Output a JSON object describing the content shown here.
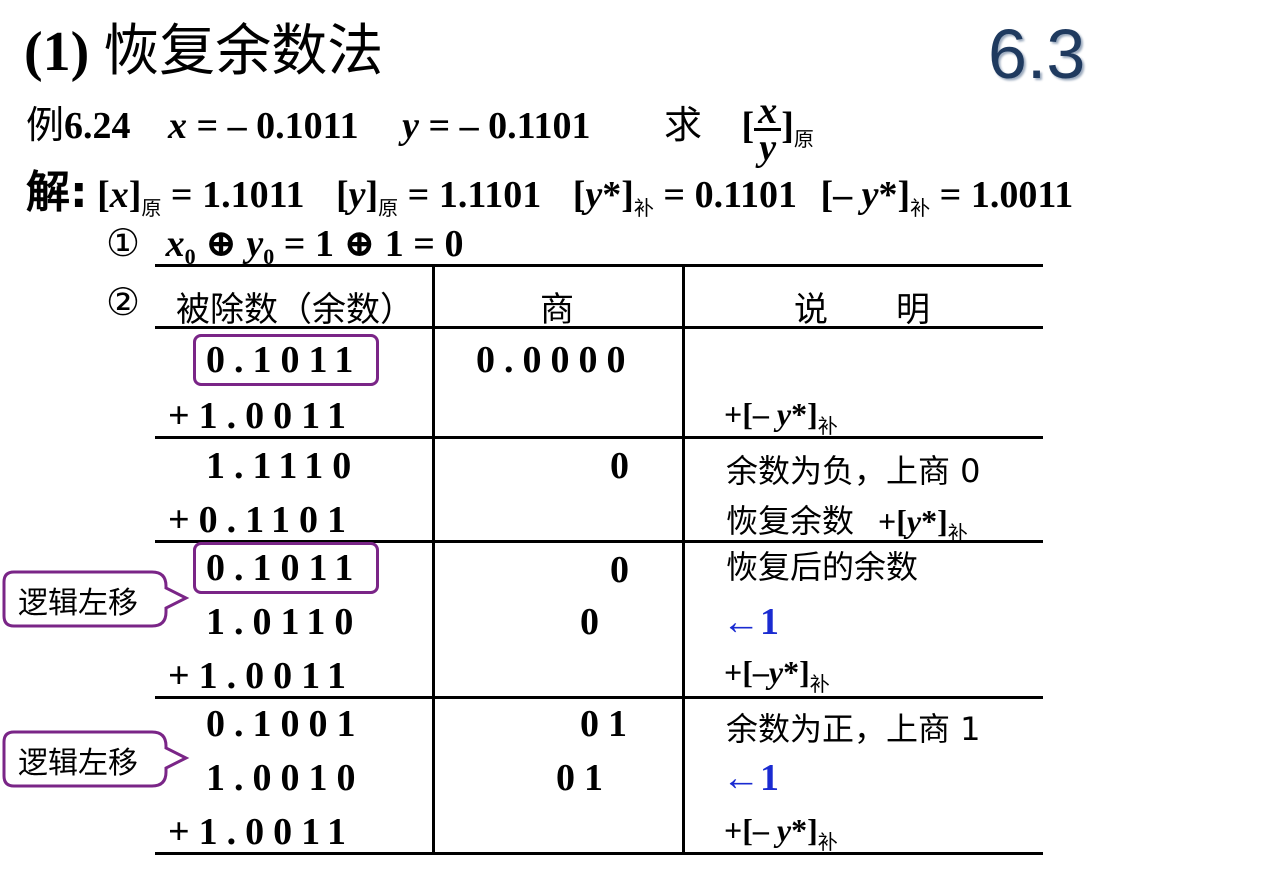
{
  "title": {
    "prefix": "(1) ",
    "text": "恢复余数法"
  },
  "section_number": "6.3",
  "example": {
    "label_zh": "例",
    "num": "6.24",
    "x_expr": "= – 0.1011",
    "y_expr": "= – 0.1101",
    "ask": "求",
    "sub": "原"
  },
  "solution": {
    "label": "解:",
    "x_orig": "= 1.1011",
    "y_orig": "= 1.1101",
    "ystar_comp": "= 0.1101",
    "negystar_comp": "= 1.0011",
    "sub_orig": "原",
    "sub_comp": "补"
  },
  "step1": {
    "marker": "①",
    "expr": "= 1 ⊕ 1 = 0"
  },
  "step2": {
    "marker": "②"
  },
  "table": {
    "headers": [
      "被除数（余数）",
      "商",
      "说　　明"
    ],
    "rows": [
      {
        "dividend": "0.1011",
        "quotient": "0.0000",
        "note": ""
      },
      {
        "dividend": "+1.0011",
        "quotient": "",
        "note": "+[– y*]补"
      },
      {
        "dividend": "1.1110",
        "quotient": "0",
        "note": "余数为负，上商 0"
      },
      {
        "dividend": "+0.1101",
        "quotient": "",
        "note": "恢复余数 +[y*]补"
      },
      {
        "dividend": "0.1011",
        "quotient": "0",
        "note": "恢复后的余数"
      },
      {
        "dividend": "1.0110",
        "quotient": "0",
        "note": "←1"
      },
      {
        "dividend": "+1.0011",
        "quotient": "",
        "note": "+[–y*]补"
      },
      {
        "dividend": "0.1001",
        "quotient": "01",
        "note": "余数为正，上商 1"
      },
      {
        "dividend": "1.0010",
        "quotient": "01",
        "note": "←1"
      },
      {
        "dividend": "+1.0011",
        "quotient": "",
        "note": "+[– y*]补"
      }
    ]
  },
  "callouts": [
    "逻辑左移",
    "逻辑左移"
  ],
  "colors": {
    "box_border": "#7a2587",
    "arrow_text": "#1a2bd1",
    "section_number": "#1f3a5f"
  }
}
